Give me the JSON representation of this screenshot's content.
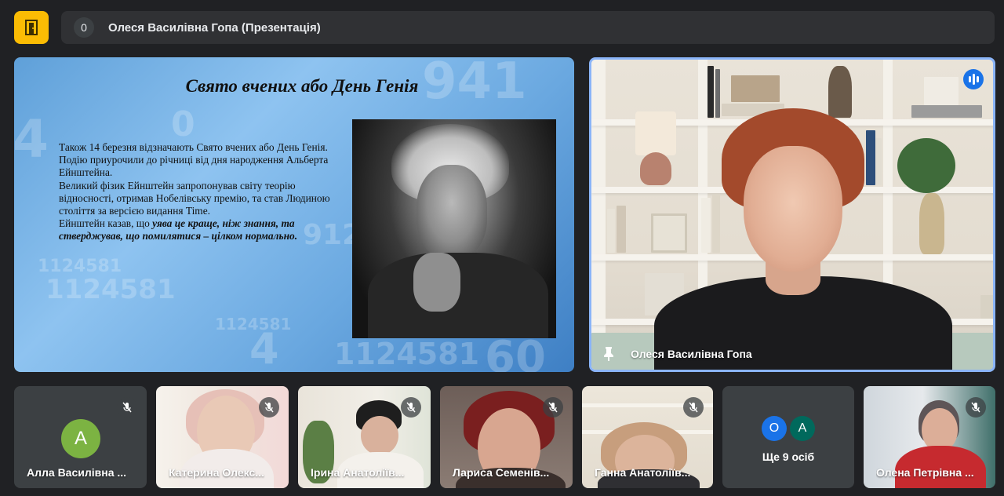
{
  "header": {
    "participant_count": "0",
    "meeting_title": "Олеся Василівна Гопа (Презентація)"
  },
  "slide": {
    "title": "Свято вчених або День Генія",
    "line1": "Також 14 березня відзначають Свято вчених або День Генія. Подію приурочили до річниці від дня народження Альберта Ейнштейна.",
    "line2": "Великий фізик Ейнштейн запропонував світу теорію відносності, отримав Нобелівську премію, та став Людиною століття за версією видання Time.",
    "line3_prefix": "Ейнштейн казав, що ",
    "line3_emphasis": "уява це краще, ніж знання, та стверджував, що помилятися – цілком нормально.",
    "decor_numbers": [
      "941",
      "4",
      "1124581",
      "1124581",
      "912",
      "0",
      "1124581",
      "4",
      "1124581",
      "60"
    ]
  },
  "speaker": {
    "name": "Олеся Василівна Гопа"
  },
  "tiles": [
    {
      "name": "Алла Василівна ...",
      "avatar_letter": "A",
      "avatar_color": "#7cb342"
    },
    {
      "name": "Катерина Олекс..."
    },
    {
      "name": "Ірина Анатоліїв..."
    },
    {
      "name": "Лариса Семенів..."
    },
    {
      "name": "Ганна Анатоліїв..."
    },
    {
      "name": "Олена Петрівна ..."
    }
  ],
  "more": {
    "label": "Ще 9 осіб",
    "avatars": [
      {
        "letter": "O",
        "color": "#1a73e8"
      },
      {
        "letter": "A",
        "color": "#00695c"
      }
    ]
  },
  "colors": {
    "accent_blue": "#8ab4f8",
    "app_icon_yellow": "#fbbc04",
    "tile_bg": "#3c4043"
  },
  "icons": [
    "exit-door-icon",
    "mic-off-icon",
    "pin-icon",
    "speaking-indicator-icon"
  ]
}
